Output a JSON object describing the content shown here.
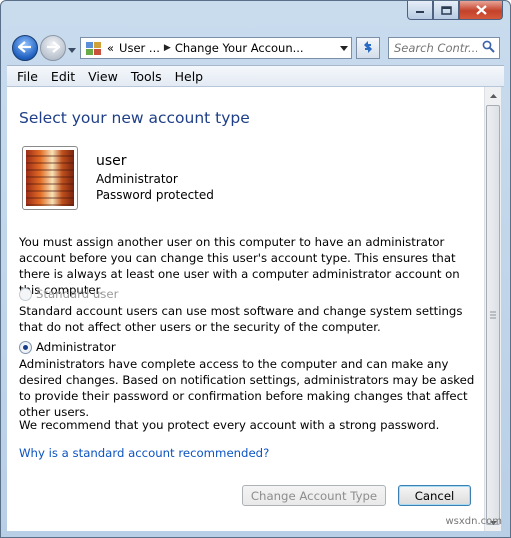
{
  "window": {
    "caption_buttons": [
      "minimize-icon",
      "maximize-icon",
      "close-icon"
    ]
  },
  "address_bar": {
    "overflow_marker": "«",
    "crumbs": [
      "User ...",
      "Change Your Accoun..."
    ]
  },
  "search": {
    "placeholder": "Search Contr..."
  },
  "menu": [
    "File",
    "Edit",
    "View",
    "Tools",
    "Help"
  ],
  "main": {
    "title": "Select your new account type",
    "user": {
      "name": "user",
      "role": "Administrator",
      "status": "Password protected"
    },
    "notice": "You must assign another user on this computer to have an administrator account before you can change this user's account type. This ensures that there is always at least one user with a computer administrator account on this computer.",
    "options": [
      {
        "label": "Standard user",
        "description": "Standard account users can use most software and change system settings that do not affect other users or the security of the computer.",
        "selected": false,
        "enabled": false
      },
      {
        "label": "Administrator",
        "description": "Administrators have complete access to the computer and can make any desired changes. Based on notification settings, administrators may be asked to provide their password or confirmation before making changes that affect other users.",
        "selected": true,
        "enabled": true
      }
    ],
    "recommendation": "We recommend that you protect every account with a strong password.",
    "help_link": "Why is a standard account recommended?"
  },
  "buttons": {
    "change": "Change Account Type",
    "cancel": "Cancel"
  },
  "watermark": "wsxdn.com",
  "colors": {
    "title": "#1e3f87",
    "link": "#0b53c1"
  }
}
